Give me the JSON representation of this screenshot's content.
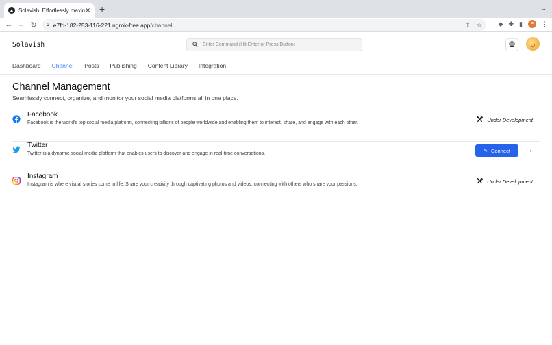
{
  "browser": {
    "tab_title": "Solavish: Effortlessly maximize",
    "tab_close": "✕",
    "new_tab": "+",
    "url_host": "e7fd-182-253-116-221.ngrok-free.app",
    "url_path": "/channel",
    "profile_initial": "E"
  },
  "header": {
    "logo": "Solavish",
    "command_placeholder": "Enter Command (Hit Enter or Press Button)"
  },
  "nav": {
    "items": [
      {
        "label": "Dashboard"
      },
      {
        "label": "Channel"
      },
      {
        "label": "Posts"
      },
      {
        "label": "Publishing"
      },
      {
        "label": "Content Library"
      },
      {
        "label": "Integration"
      }
    ],
    "active": "Channel"
  },
  "page": {
    "title": "Channel Management",
    "subtitle": "Seamlessly connect, organize, and monitor your social media platforms all in one place."
  },
  "channels": [
    {
      "name": "Facebook",
      "description": "Facebook is the world's top social media platform, connecting billions of people worldwide and enabling them to interact, share, and engage with each other.",
      "status": "Under Development",
      "icon": "facebook-icon",
      "color": "#1877f2"
    },
    {
      "name": "Twitter",
      "description": "Twitter is a dynamic social media platform that enables users to discover and engage in real-time conversations.",
      "action": "Connect",
      "icon": "twitter-icon",
      "color": "#1d9bf0"
    },
    {
      "name": "Instagram",
      "description": "Instagram is where visual stories come to life. Share your creativity through captivating photos and videos, connecting with others who share your passions.",
      "status": "Under Development",
      "icon": "instagram-icon",
      "color": "#d6249f"
    }
  ],
  "colors": {
    "accent": "#3b82f6",
    "button": "#2563eb"
  }
}
